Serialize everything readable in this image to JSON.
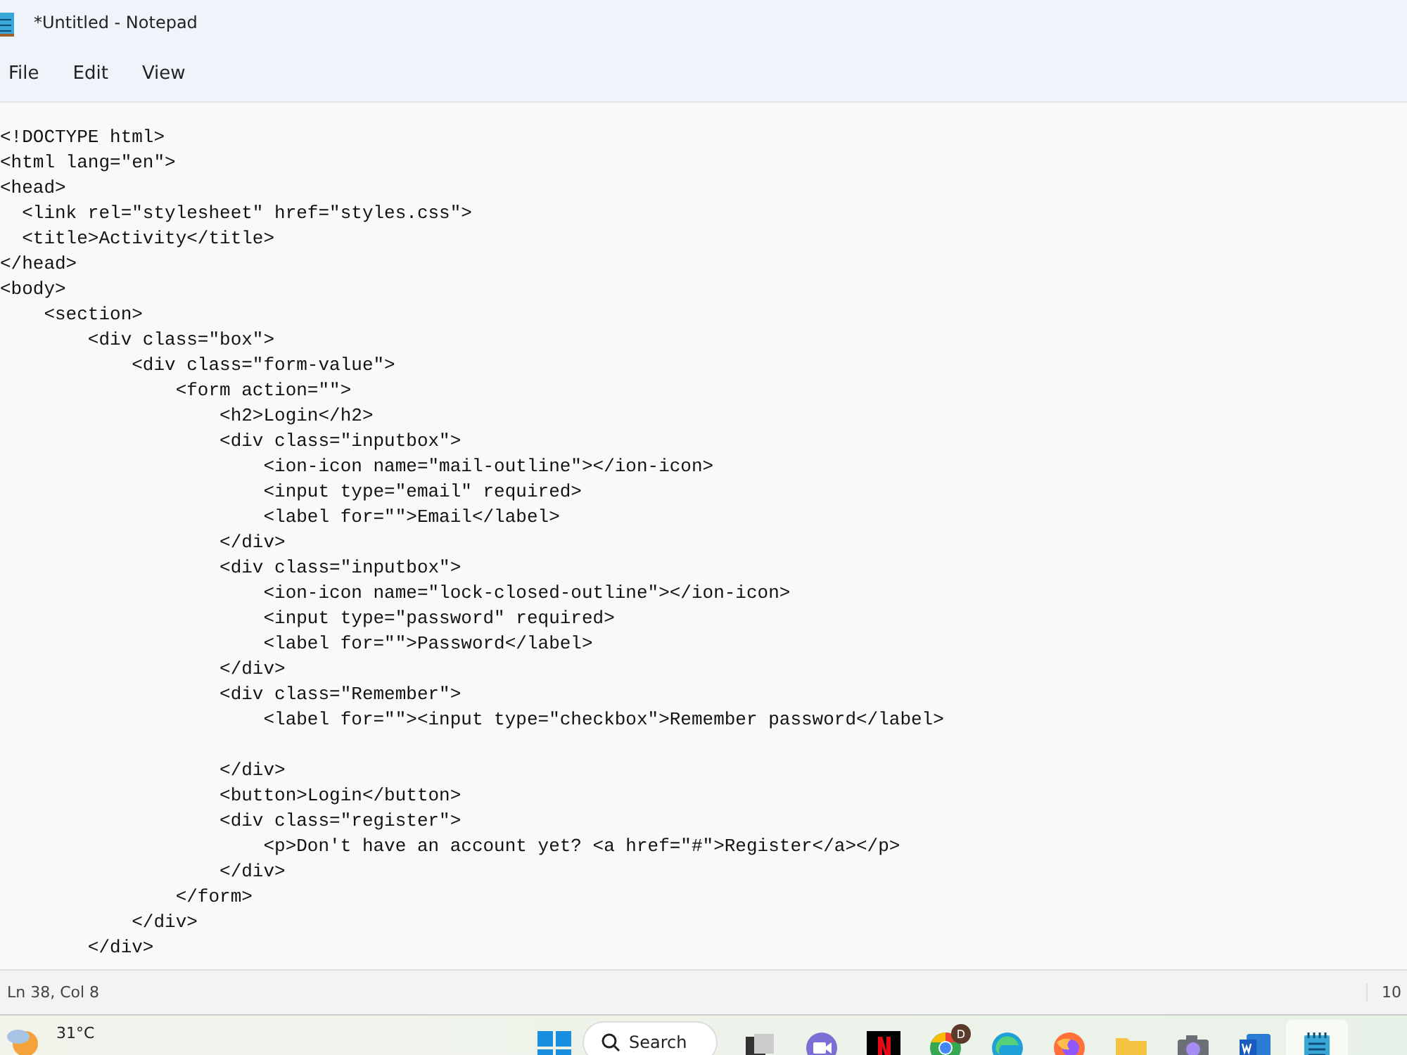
{
  "window": {
    "title": "*Untitled - Notepad"
  },
  "menu": [
    {
      "label": "File"
    },
    {
      "label": "Edit"
    },
    {
      "label": "View"
    }
  ],
  "editor": {
    "lines": [
      "<!DOCTYPE html>",
      "<html lang=\"en\">",
      "<head>",
      "  <link rel=\"stylesheet\" href=\"styles.css\">",
      "  <title>Activity</title>",
      "</head>",
      "<body>",
      "    <section>",
      "        <div class=\"box\">",
      "            <div class=\"form-value\">",
      "                <form action=\"\">",
      "                    <h2>Login</h2>",
      "                    <div class=\"inputbox\">",
      "                        <ion-icon name=\"mail-outline\"></ion-icon>",
      "                        <input type=\"email\" required>",
      "                        <label for=\"\">Email</label>",
      "                    </div>",
      "                    <div class=\"inputbox\">",
      "                        <ion-icon name=\"lock-closed-outline\"></ion-icon>",
      "                        <input type=\"password\" required>",
      "                        <label for=\"\">Password</label>",
      "                    </div>",
      "                    <div class=\"Remember\">",
      "                        <label for=\"\"><input type=\"checkbox\">Remember password</label>",
      {
        "kind": "blank"
      },
      "                    </div>",
      "                    <button>Login</button>",
      "                    <div class=\"register\">",
      "                        <p>Don't have an account yet? <a href=\"#\">Register</a></p>",
      "                    </div>",
      "                </form>",
      "            </div>",
      "        </div>"
    ]
  },
  "status_bar": {
    "position": "Ln 38, Col 8",
    "zoom": "10"
  },
  "taskbar": {
    "weather": {
      "temperature": "31°C"
    },
    "search": {
      "label": "Search"
    },
    "apps": [
      {
        "kind": "taskview",
        "active": false
      },
      {
        "kind": "meet",
        "active": false
      },
      {
        "kind": "netflix",
        "active": false
      },
      {
        "kind": "chrome",
        "active": false,
        "badge": "D"
      },
      {
        "kind": "edge",
        "active": false
      },
      {
        "kind": "firefox",
        "active": false
      },
      {
        "kind": "folder",
        "active": false
      },
      {
        "kind": "camera",
        "active": false
      },
      {
        "kind": "word",
        "active": false
      },
      {
        "kind": "notepad",
        "active": true
      }
    ]
  }
}
